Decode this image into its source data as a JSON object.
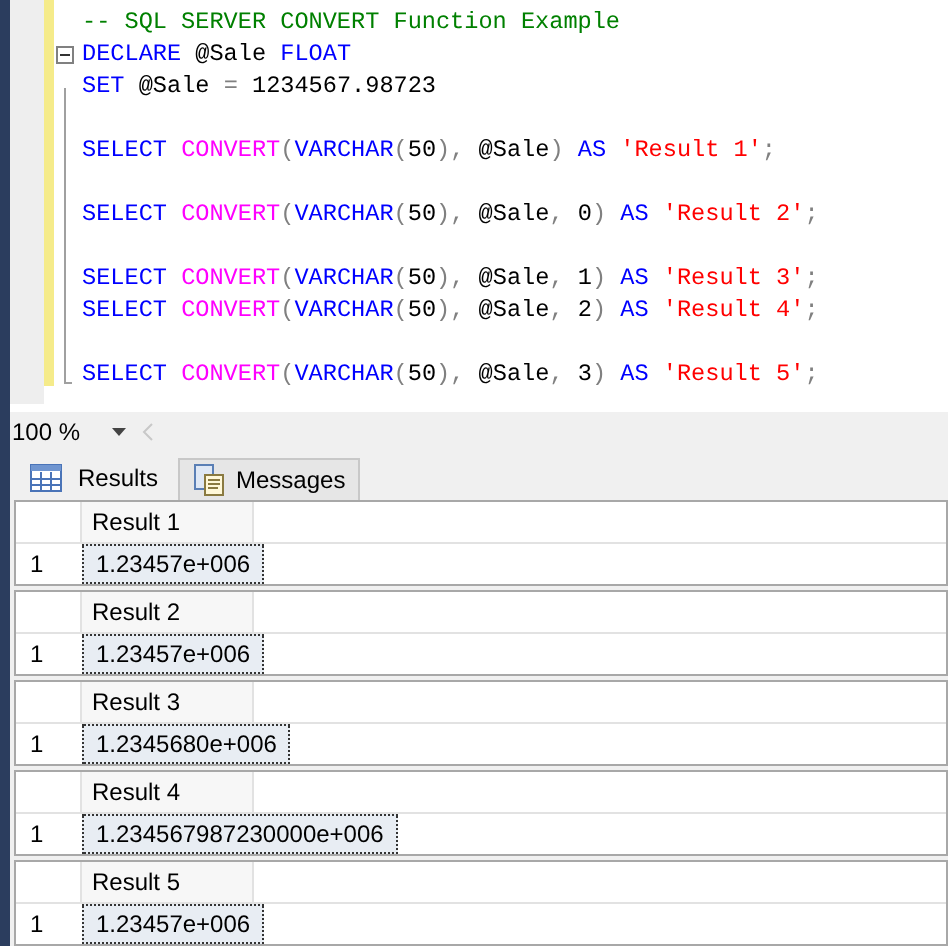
{
  "editor": {
    "lines": [
      {
        "kind": "code",
        "tokens": [
          {
            "kind": "comment",
            "text": "-- SQL SERVER CONVERT Function Example"
          }
        ]
      },
      {
        "kind": "block_start",
        "tokens": [
          {
            "kind": "keyword",
            "text": "DECLARE"
          },
          {
            "kind": "plain",
            "text": " @Sale "
          },
          {
            "kind": "keyword",
            "text": "FLOAT"
          }
        ]
      },
      {
        "kind": "code",
        "tokens": [
          {
            "kind": "keyword",
            "text": "SET"
          },
          {
            "kind": "plain",
            "text": " @Sale "
          },
          {
            "kind": "operator",
            "text": "="
          },
          {
            "kind": "plain",
            "text": " 1234567.98723"
          }
        ]
      },
      {
        "kind": "blank"
      },
      {
        "kind": "code",
        "tokens": [
          {
            "kind": "keyword",
            "text": "SELECT "
          },
          {
            "kind": "function",
            "text": "CONVERT"
          },
          {
            "kind": "operator",
            "text": "("
          },
          {
            "kind": "keyword",
            "text": "VARCHAR"
          },
          {
            "kind": "operator",
            "text": "("
          },
          {
            "kind": "plain",
            "text": "50"
          },
          {
            "kind": "operator",
            "text": "),"
          },
          {
            "kind": "plain",
            "text": " @Sale"
          },
          {
            "kind": "operator",
            "text": ")"
          },
          {
            "kind": "keyword",
            "text": " AS "
          },
          {
            "kind": "string",
            "text": "'Result 1'"
          },
          {
            "kind": "operator",
            "text": ";"
          }
        ]
      },
      {
        "kind": "blank"
      },
      {
        "kind": "code",
        "tokens": [
          {
            "kind": "keyword",
            "text": "SELECT "
          },
          {
            "kind": "function",
            "text": "CONVERT"
          },
          {
            "kind": "operator",
            "text": "("
          },
          {
            "kind": "keyword",
            "text": "VARCHAR"
          },
          {
            "kind": "operator",
            "text": "("
          },
          {
            "kind": "plain",
            "text": "50"
          },
          {
            "kind": "operator",
            "text": "),"
          },
          {
            "kind": "plain",
            "text": " @Sale"
          },
          {
            "kind": "operator",
            "text": ","
          },
          {
            "kind": "plain",
            "text": " 0"
          },
          {
            "kind": "operator",
            "text": ")"
          },
          {
            "kind": "keyword",
            "text": " AS "
          },
          {
            "kind": "string",
            "text": "'Result 2'"
          },
          {
            "kind": "operator",
            "text": ";"
          }
        ]
      },
      {
        "kind": "blank"
      },
      {
        "kind": "code",
        "tokens": [
          {
            "kind": "keyword",
            "text": "SELECT "
          },
          {
            "kind": "function",
            "text": "CONVERT"
          },
          {
            "kind": "operator",
            "text": "("
          },
          {
            "kind": "keyword",
            "text": "VARCHAR"
          },
          {
            "kind": "operator",
            "text": "("
          },
          {
            "kind": "plain",
            "text": "50"
          },
          {
            "kind": "operator",
            "text": "),"
          },
          {
            "kind": "plain",
            "text": " @Sale"
          },
          {
            "kind": "operator",
            "text": ","
          },
          {
            "kind": "plain",
            "text": " 1"
          },
          {
            "kind": "operator",
            "text": ")"
          },
          {
            "kind": "keyword",
            "text": " AS "
          },
          {
            "kind": "string",
            "text": "'Result 3'"
          },
          {
            "kind": "operator",
            "text": ";"
          }
        ]
      },
      {
        "kind": "code",
        "tokens": [
          {
            "kind": "keyword",
            "text": "SELECT "
          },
          {
            "kind": "function",
            "text": "CONVERT"
          },
          {
            "kind": "operator",
            "text": "("
          },
          {
            "kind": "keyword",
            "text": "VARCHAR"
          },
          {
            "kind": "operator",
            "text": "("
          },
          {
            "kind": "plain",
            "text": "50"
          },
          {
            "kind": "operator",
            "text": "),"
          },
          {
            "kind": "plain",
            "text": " @Sale"
          },
          {
            "kind": "operator",
            "text": ","
          },
          {
            "kind": "plain",
            "text": " 2"
          },
          {
            "kind": "operator",
            "text": ")"
          },
          {
            "kind": "keyword",
            "text": " AS "
          },
          {
            "kind": "string",
            "text": "'Result 4'"
          },
          {
            "kind": "operator",
            "text": ";"
          }
        ]
      },
      {
        "kind": "blank"
      },
      {
        "kind": "code",
        "tokens": [
          {
            "kind": "keyword",
            "text": "SELECT "
          },
          {
            "kind": "function",
            "text": "CONVERT"
          },
          {
            "kind": "operator",
            "text": "("
          },
          {
            "kind": "keyword",
            "text": "VARCHAR"
          },
          {
            "kind": "operator",
            "text": "("
          },
          {
            "kind": "plain",
            "text": "50"
          },
          {
            "kind": "operator",
            "text": "),"
          },
          {
            "kind": "plain",
            "text": " @Sale"
          },
          {
            "kind": "operator",
            "text": ","
          },
          {
            "kind": "plain",
            "text": " 3"
          },
          {
            "kind": "operator",
            "text": ")"
          },
          {
            "kind": "keyword",
            "text": " AS "
          },
          {
            "kind": "string",
            "text": "'Result 5'"
          },
          {
            "kind": "operator",
            "text": ";"
          }
        ]
      }
    ]
  },
  "zoom": {
    "value": "100 %"
  },
  "tabs": [
    {
      "label": "Results",
      "selected": true,
      "kind": "grid"
    },
    {
      "label": "Messages",
      "selected": false,
      "kind": "messages"
    }
  ],
  "results": [
    {
      "column": "Result 1",
      "rows": [
        {
          "number": "1",
          "value": "1.23457e+006",
          "selected": true
        }
      ]
    },
    {
      "column": "Result 2",
      "rows": [
        {
          "number": "1",
          "value": "1.23457e+006",
          "selected": true
        }
      ]
    },
    {
      "column": "Result 3",
      "rows": [
        {
          "number": "1",
          "value": "1.2345680e+006",
          "selected": true
        }
      ]
    },
    {
      "column": "Result 4",
      "rows": [
        {
          "number": "1",
          "value": "1.234567987230000e+006",
          "selected": true
        }
      ]
    },
    {
      "column": "Result 5",
      "rows": [
        {
          "number": "1",
          "value": "1.23457e+006",
          "selected": true
        }
      ]
    }
  ]
}
